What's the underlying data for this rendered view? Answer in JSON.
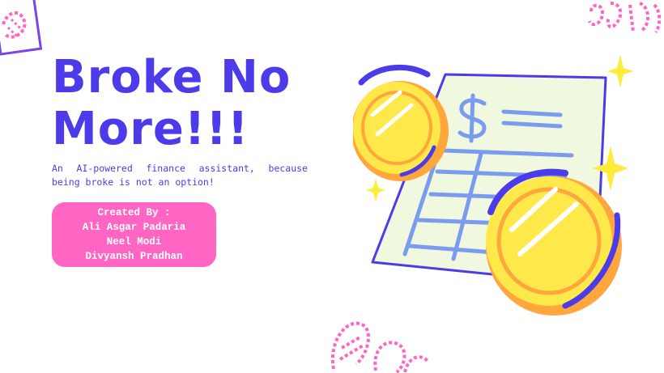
{
  "slide": {
    "title_lines": [
      "Broke No",
      "More!!!"
    ],
    "subtitle": "An AI-powered finance assistant, because being broke is not an option!",
    "credits": {
      "heading": "Created  By :",
      "names": [
        "Ali Asgar Padaria",
        "Neel Modi",
        "Divyansh Pradhan"
      ]
    }
  },
  "colors": {
    "title": "#4b3bea",
    "credits_bg": "#ff66c4",
    "coin_yellow": "#ffe94a",
    "coin_orange": "#ffa63d",
    "doodle_pink": "#ff66c4",
    "sparkle": "#ffeb3b",
    "paper": "#f1f8e0"
  },
  "icons": [
    "receipt-illustration",
    "coin-icon",
    "sparkle-icon",
    "dollar-sign-icon",
    "pink-doodle"
  ]
}
